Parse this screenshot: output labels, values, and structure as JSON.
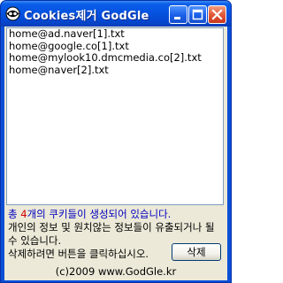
{
  "window": {
    "title": "Cookies제거 GodGle",
    "icon": "cookie-eye-icon"
  },
  "caption_buttons": {
    "minimize": "minimize-icon",
    "maximize": "maximize-icon",
    "close": "close-icon"
  },
  "cookie_list": {
    "items": [
      "home@ad.naver[1].txt",
      "home@google.co[1].txt",
      "home@mylook10.dmcmedia.co[2].txt",
      "home@naver[2].txt"
    ]
  },
  "info": {
    "count_prefix": "총 ",
    "count": "4",
    "count_suffix": "개의 쿠키들이 생성되어 있습니다.",
    "warning": "개인의 정보 및 원치않는 정보들이 유출되거나 될 수 있습니다.",
    "instruction": "삭제하려면 버튼을 클릭하십시오."
  },
  "delete_button": {
    "label": "삭제"
  },
  "footer": {
    "text": "(c)2009 www.GodGle.kr"
  },
  "colors": {
    "titlebar": "#0553e1",
    "count_text": "#0000c0",
    "count_number": "#d00000",
    "face": "#ece9d8"
  }
}
